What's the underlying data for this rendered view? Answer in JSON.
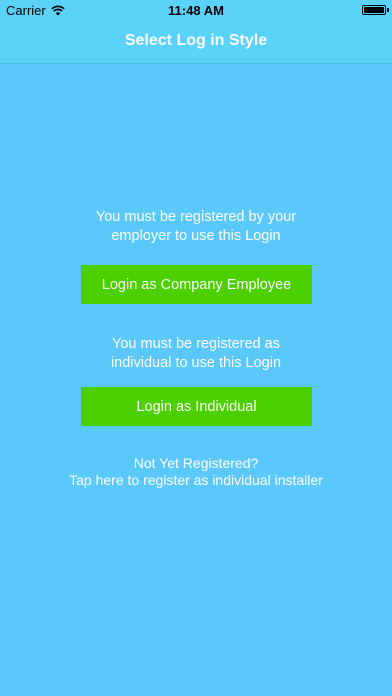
{
  "status_bar": {
    "carrier": "Carrier",
    "time": "11:48 AM",
    "wifi_icon": "wifi-icon",
    "battery_icon": "battery-icon"
  },
  "nav": {
    "title": "Select Log in Style"
  },
  "company": {
    "info_line1": "You must be registered by your",
    "info_line2": "employer to use this Login",
    "button_label": "Login as Company Employee"
  },
  "individual": {
    "info_line1": "You must be registered as",
    "info_line2": "individual to use this Login",
    "button_label": "Login as Individual"
  },
  "register": {
    "line1": "Not Yet Registered?",
    "line2": "Tap here to register as individual installer"
  },
  "colors": {
    "background": "#5ac8fa",
    "nav_bar": "#5ad2f9",
    "button": "#4cd000",
    "text": "#ffffff"
  }
}
